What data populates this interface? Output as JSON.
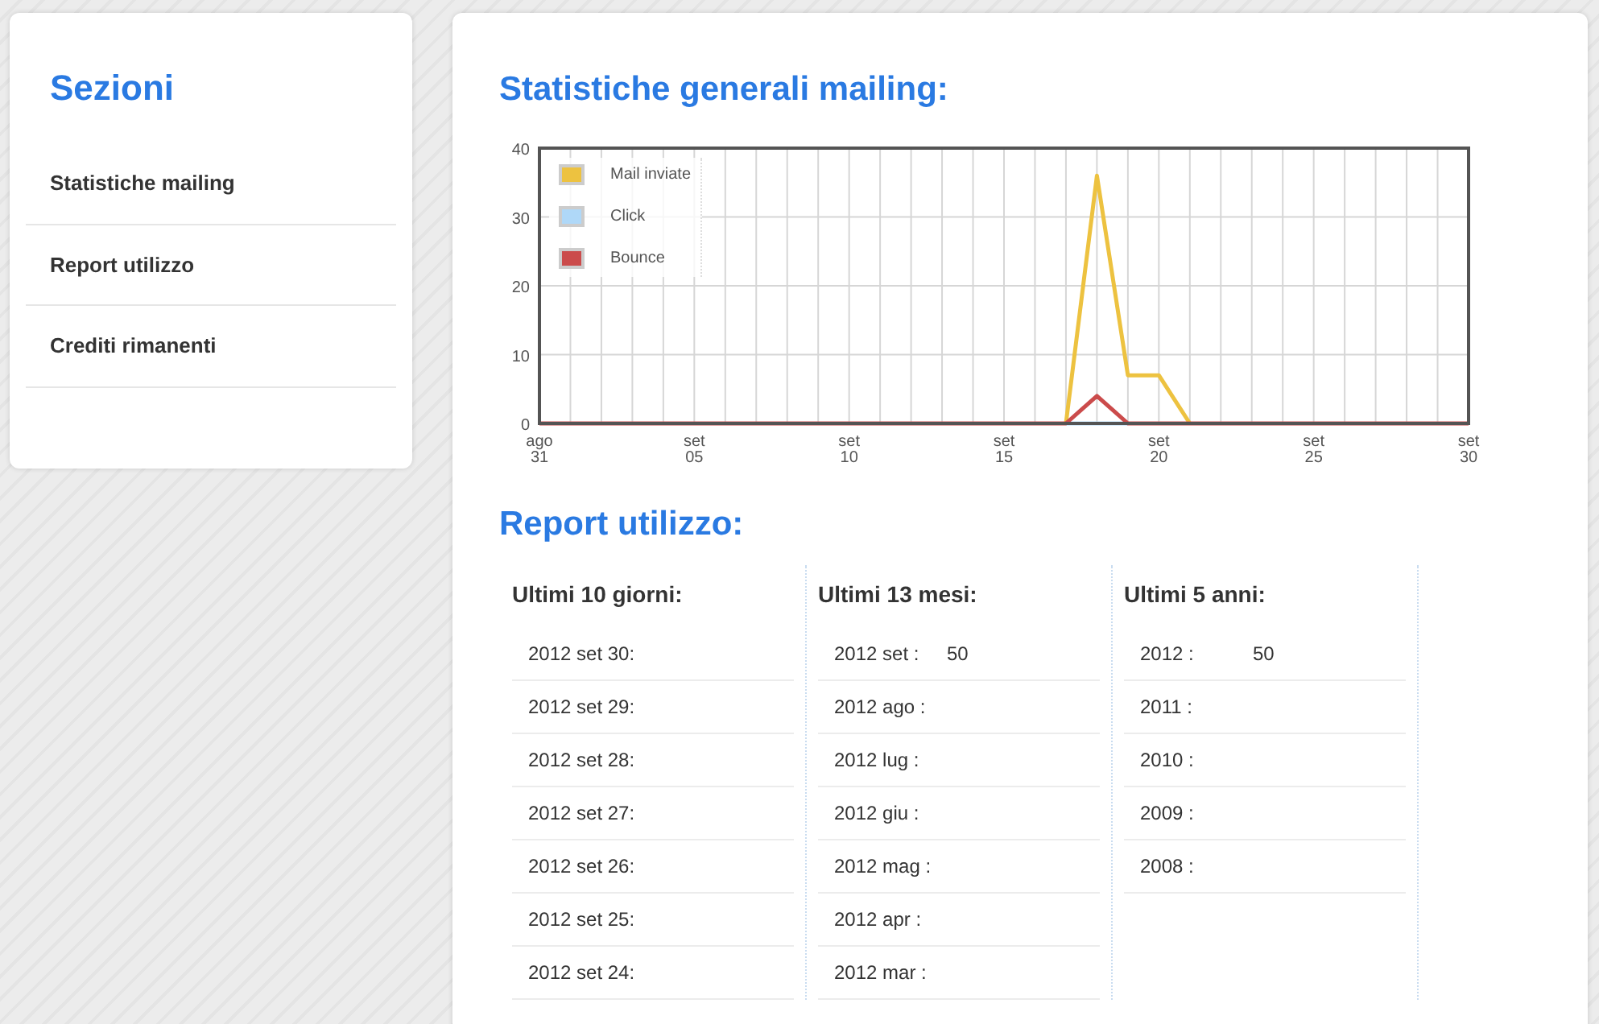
{
  "sidebar": {
    "title": "Sezioni",
    "items": [
      {
        "label": "Statistiche mailing"
      },
      {
        "label": "Report utilizzo"
      },
      {
        "label": "Crediti rimanenti"
      }
    ]
  },
  "stats": {
    "title": "Statistiche generali mailing:",
    "chart_data": {
      "type": "line",
      "categories": [
        "ago 31",
        null,
        null,
        null,
        null,
        "set 05",
        null,
        null,
        null,
        null,
        "set 10",
        null,
        null,
        null,
        null,
        "set 15",
        null,
        null,
        null,
        null,
        "set 20",
        null,
        null,
        null,
        null,
        "set 25",
        null,
        null,
        null,
        null,
        "set 30"
      ],
      "ylim": [
        0,
        40
      ],
      "grid": true,
      "legend": true,
      "yticks": [
        0,
        10,
        20,
        30,
        40
      ],
      "series": [
        {
          "name": "Mail inviate",
          "color": "#edc240",
          "values": [
            null,
            null,
            null,
            null,
            null,
            null,
            null,
            null,
            null,
            null,
            null,
            null,
            null,
            null,
            null,
            null,
            null,
            0,
            36,
            7,
            7,
            0,
            null,
            null,
            null,
            null,
            null,
            null,
            null,
            null,
            null
          ]
        },
        {
          "name": "Click",
          "color": "#afd8f8",
          "values": [
            null,
            null,
            null,
            null,
            null,
            null,
            null,
            null,
            null,
            null,
            null,
            null,
            null,
            null,
            null,
            null,
            null,
            0,
            0,
            0,
            null,
            null,
            null,
            null,
            null,
            null,
            null,
            null,
            null,
            null,
            null
          ]
        },
        {
          "name": "Bounce",
          "color": "#cb4b4b",
          "values": [
            0,
            0,
            0,
            0,
            0,
            0,
            0,
            0,
            0,
            0,
            0,
            0,
            0,
            0,
            0,
            0,
            0,
            0,
            4,
            0,
            0,
            0,
            0,
            0,
            0,
            0,
            0,
            0,
            0,
            0,
            0
          ]
        }
      ]
    }
  },
  "report": {
    "title": "Report utilizzo:",
    "columns": [
      {
        "heading": "Ultimi 10 giorni:",
        "rows": [
          {
            "label": "2012 set 30:"
          },
          {
            "label": "2012 set 29:"
          },
          {
            "label": "2012 set 28:"
          },
          {
            "label": "2012 set 27:"
          },
          {
            "label": "2012 set 26:"
          },
          {
            "label": "2012 set 25:"
          },
          {
            "label": "2012 set 24:"
          }
        ]
      },
      {
        "heading": "Ultimi 13 mesi:",
        "rows": [
          {
            "label": "2012 set :",
            "value": "50"
          },
          {
            "label": "2012 ago :"
          },
          {
            "label": "2012 lug :"
          },
          {
            "label": "2012 giu :"
          },
          {
            "label": "2012 mag :"
          },
          {
            "label": "2012 apr :"
          },
          {
            "label": "2012 mar :"
          }
        ]
      },
      {
        "heading": "Ultimi 5 anni:",
        "rows": [
          {
            "label": "2012 :",
            "value": "50"
          },
          {
            "label": "2011 :"
          },
          {
            "label": "2010 :"
          },
          {
            "label": "2009 :"
          },
          {
            "label": "2008 :"
          }
        ]
      }
    ]
  }
}
